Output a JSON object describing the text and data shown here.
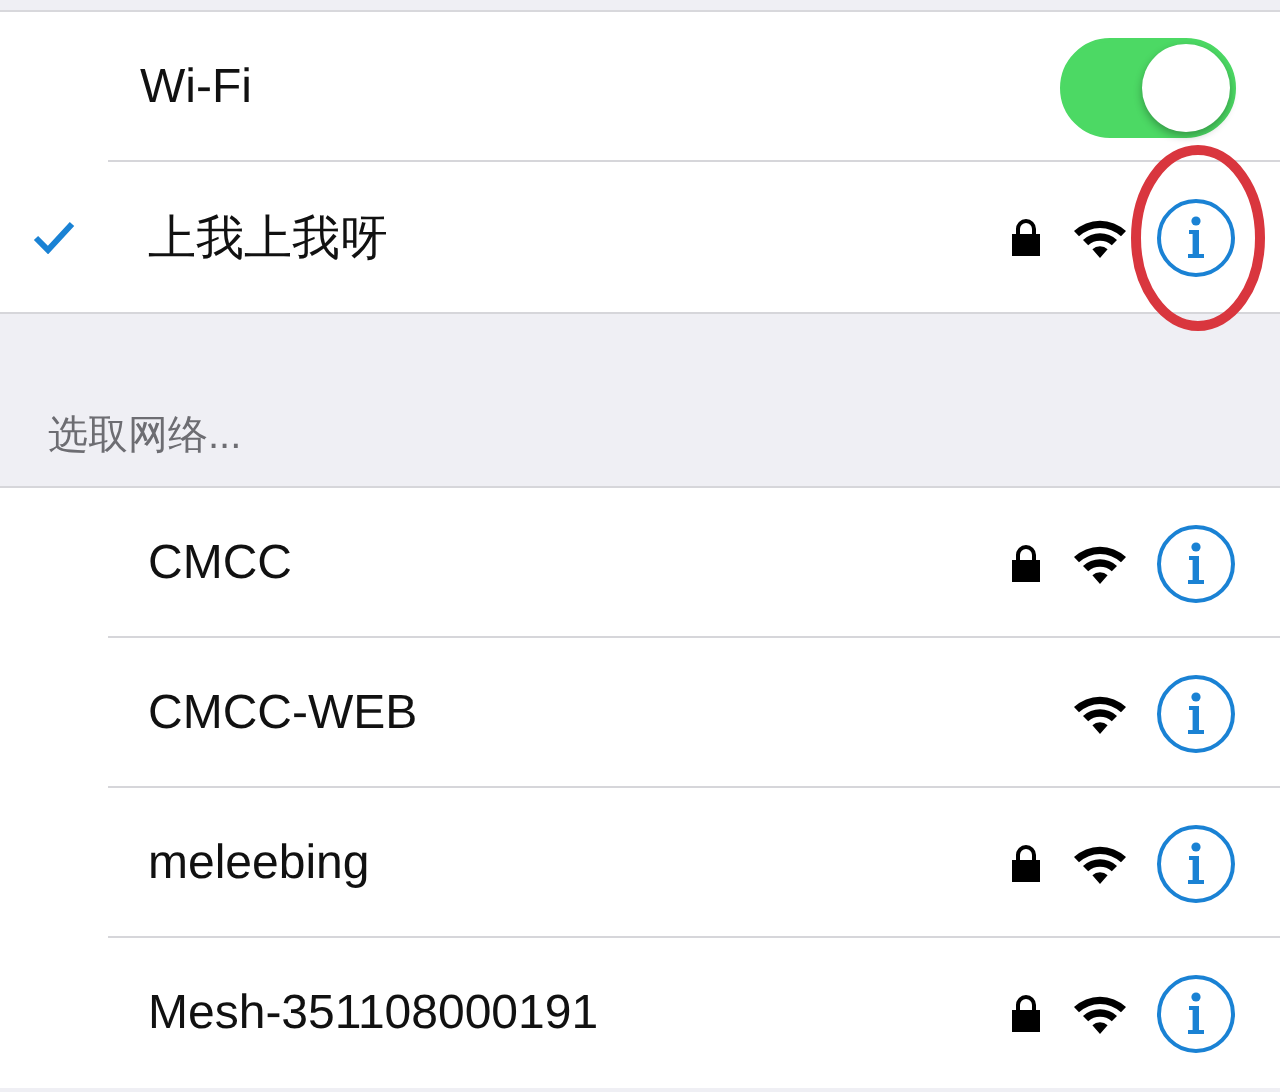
{
  "wifi": {
    "label": "Wi-Fi",
    "on": true
  },
  "connected": {
    "name": "上我上我呀",
    "selected": true,
    "secured": true,
    "highlighted": true
  },
  "section_header": "选取网络...",
  "networks": [
    {
      "name": "CMCC",
      "secured": true
    },
    {
      "name": "CMCC-WEB",
      "secured": false
    },
    {
      "name": "meleebing",
      "secured": true
    },
    {
      "name": "Mesh-351108000191",
      "secured": true
    }
  ]
}
